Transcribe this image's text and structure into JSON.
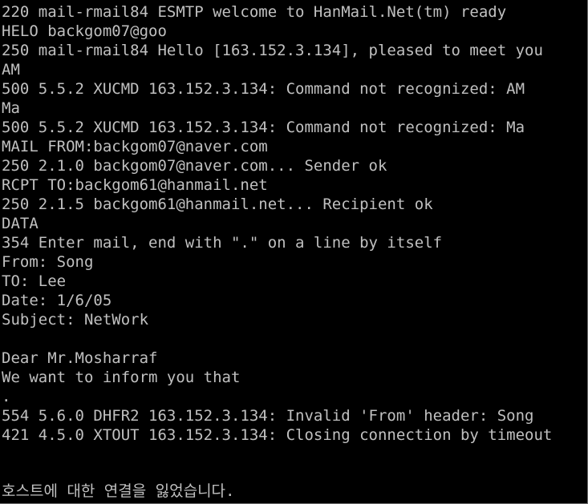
{
  "console": {
    "text_color": "#c0c0c0",
    "background": "#000000",
    "lines": [
      "220 mail-rmail84 ESMTP welcome to HanMail.Net(tm) ready",
      "HELO backgom07@goo",
      "250 mail-rmail84 Hello [163.152.3.134], pleased to meet you",
      "AM",
      "500 5.5.2 XUCMD 163.152.3.134: Command not recognized: AM",
      "Ma",
      "500 5.5.2 XUCMD 163.152.3.134: Command not recognized: Ma",
      "MAIL FROM:backgom07@naver.com",
      "250 2.1.0 backgom07@naver.com... Sender ok",
      "RCPT TO:backgom61@hanmail.net",
      "250 2.1.5 backgom61@hanmail.net... Recipient ok",
      "DATA",
      "354 Enter mail, end with \".\" on a line by itself",
      "From: Song",
      "TO: Lee",
      "Date: 1/6/05",
      "Subject: NetWork",
      "",
      "Dear Mr.Mosharraf",
      "We want to inform you that",
      ".",
      "554 5.6.0 DHFR2 163.152.3.134: Invalid 'From' header: Song",
      "421 4.5.0 XTOUT 163.152.3.134: Closing connection by timeout"
    ],
    "status_message": "호스트에 대한 연결을 잃었습니다."
  }
}
